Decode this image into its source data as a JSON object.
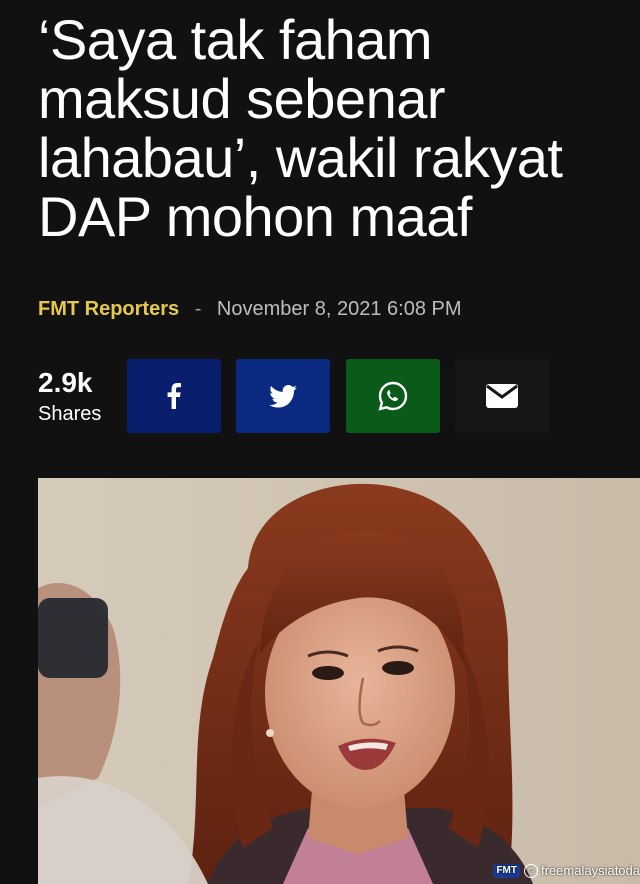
{
  "article": {
    "headline_lines": [
      "‘Saya tak faham",
      "maksud sebenar",
      "lahabau’, wakil rakyat",
      "DAP mohon maaf"
    ],
    "author": "FMT Reporters",
    "separator": "-",
    "date": "November 8, 2021 6:08 PM"
  },
  "shares": {
    "count": "2.9k",
    "label": "Shares"
  },
  "share_buttons": [
    {
      "name": "facebook",
      "icon": "facebook-icon",
      "color": "#0a1e6e"
    },
    {
      "name": "twitter",
      "icon": "twitter-icon",
      "color": "#0a2a82"
    },
    {
      "name": "whatsapp",
      "icon": "whatsapp-icon",
      "color": "#0a5a1a"
    },
    {
      "name": "email",
      "icon": "envelope-icon",
      "color": "#161616"
    }
  ],
  "photo": {
    "watermark_logo": "FMT",
    "watermark_copyright": "©",
    "watermark_text": "freemalaysiatoda"
  },
  "colors": {
    "background": "#111111",
    "author": "#e6c84a",
    "date": "#bdbdbd"
  }
}
